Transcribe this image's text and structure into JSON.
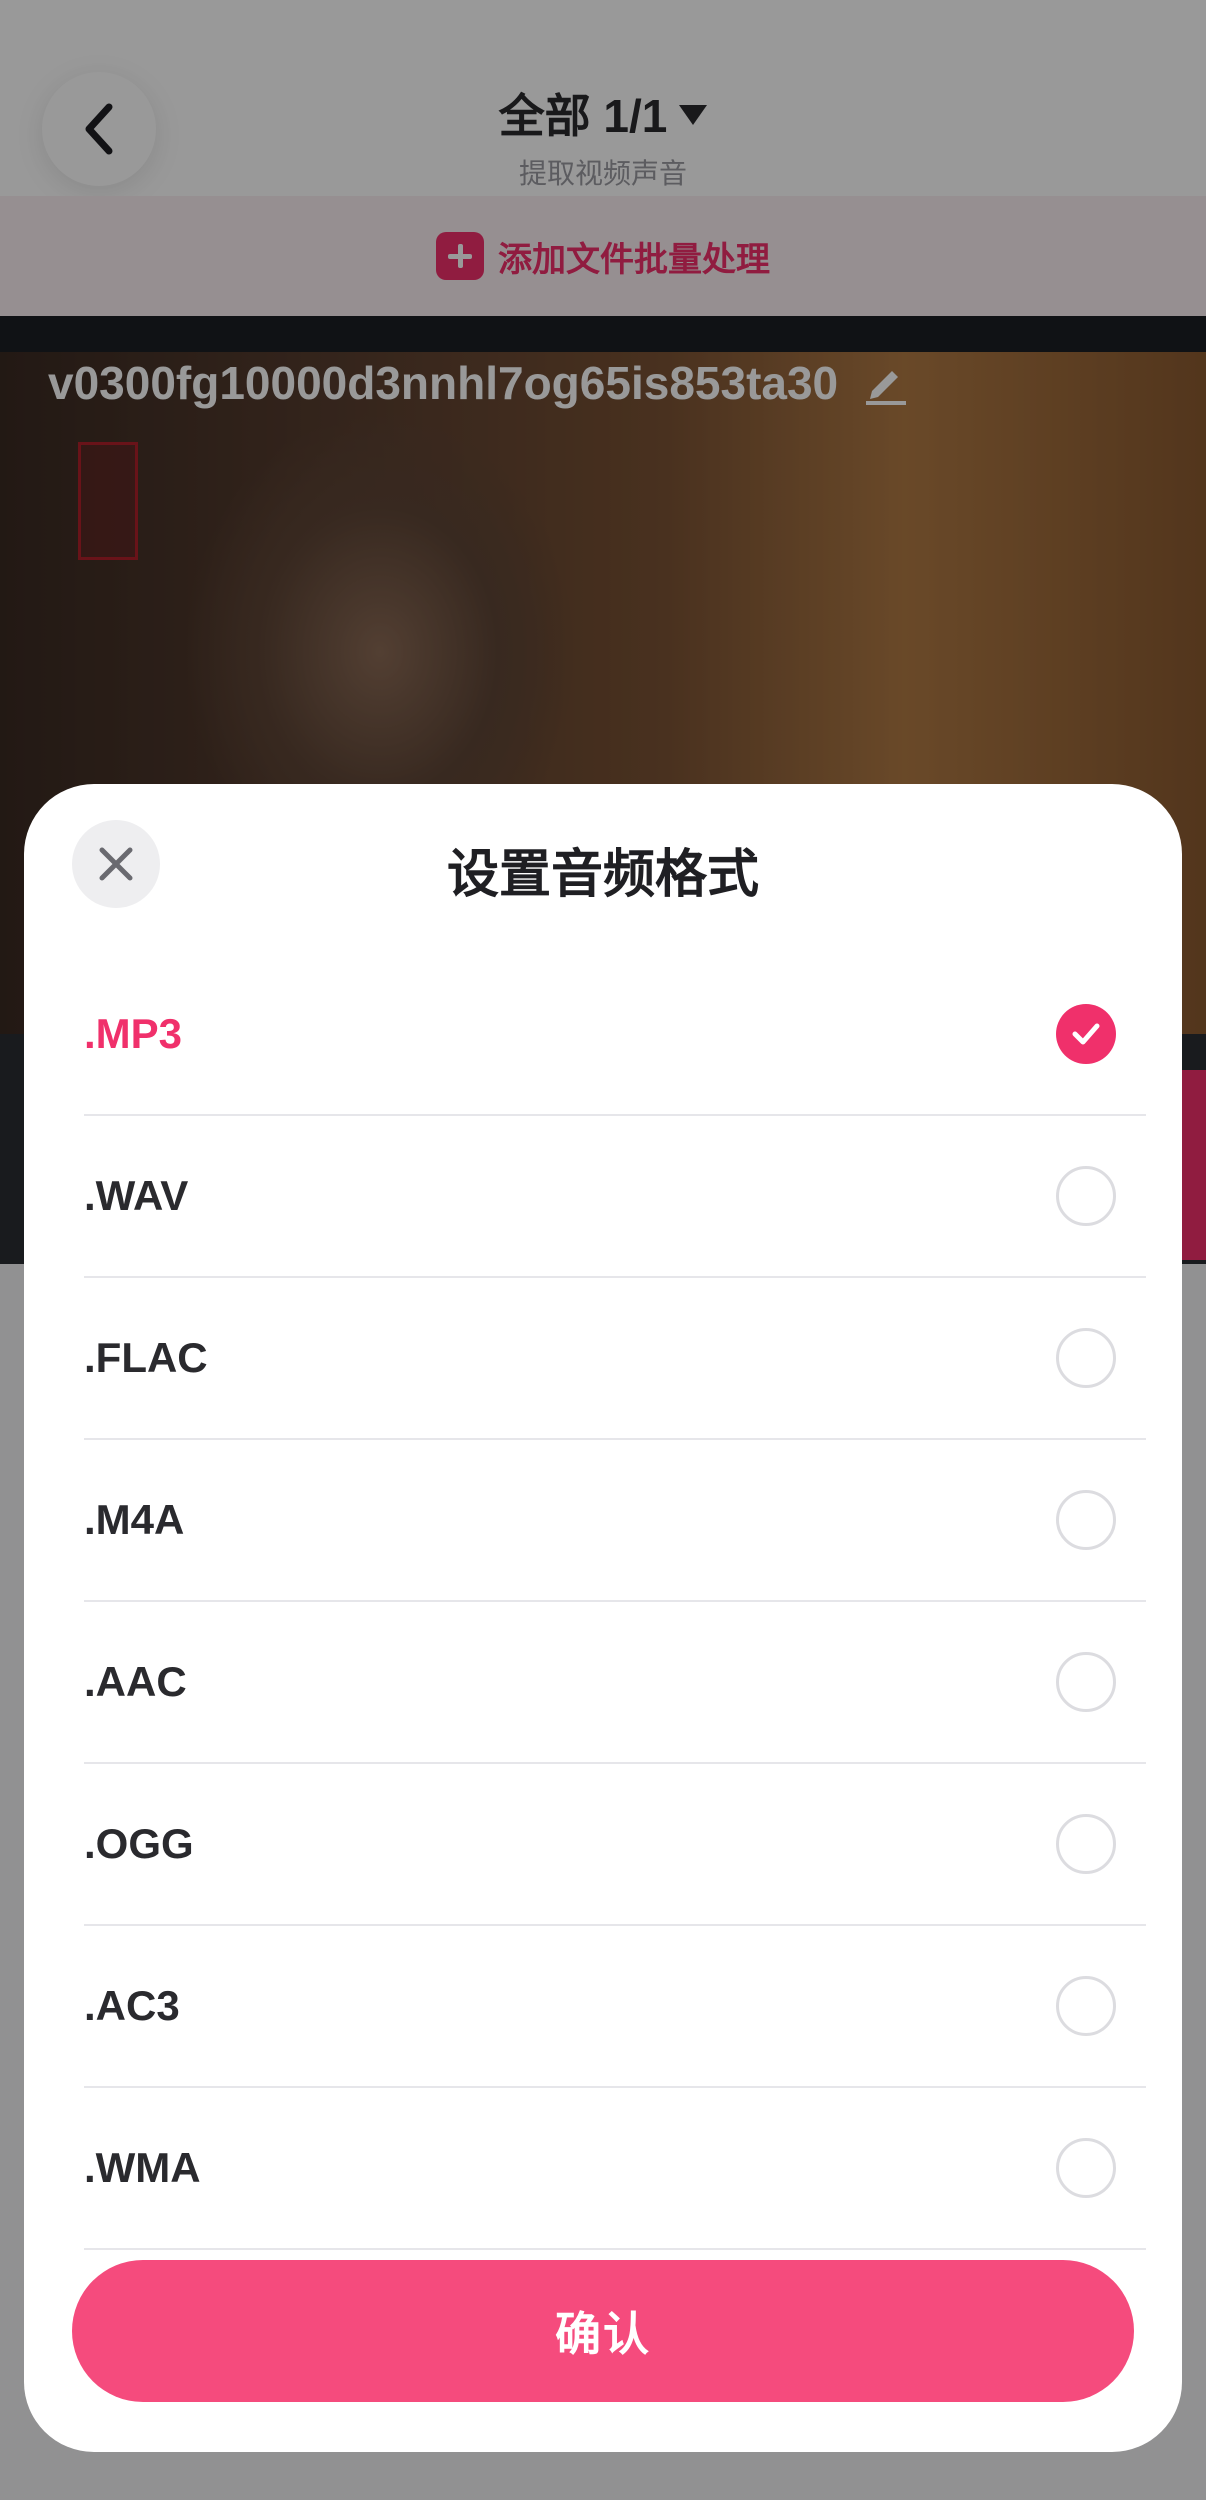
{
  "header": {
    "title": "全部 1/1",
    "subtitle": "提取视频声音"
  },
  "add_bar": {
    "label": "添加文件批量处理"
  },
  "video": {
    "file_name": "v0300fg10000d3nnhl7og65is853ta30"
  },
  "sheet": {
    "title": "设置音频格式",
    "options": [
      {
        "label": ".MP3",
        "selected": true
      },
      {
        "label": ".WAV",
        "selected": false
      },
      {
        "label": ".FLAC",
        "selected": false
      },
      {
        "label": ".M4A",
        "selected": false
      },
      {
        "label": ".AAC",
        "selected": false
      },
      {
        "label": ".OGG",
        "selected": false
      },
      {
        "label": ".AC3",
        "selected": false
      },
      {
        "label": ".WMA",
        "selected": false
      }
    ],
    "confirm_label": "确认"
  },
  "colors": {
    "accent": "#f0306b",
    "confirm": "#f54b7d"
  },
  "icons": {
    "back": "chevron-left-icon",
    "close": "close-icon",
    "add": "plus-icon",
    "edit": "pencil-icon",
    "check": "check-icon"
  }
}
